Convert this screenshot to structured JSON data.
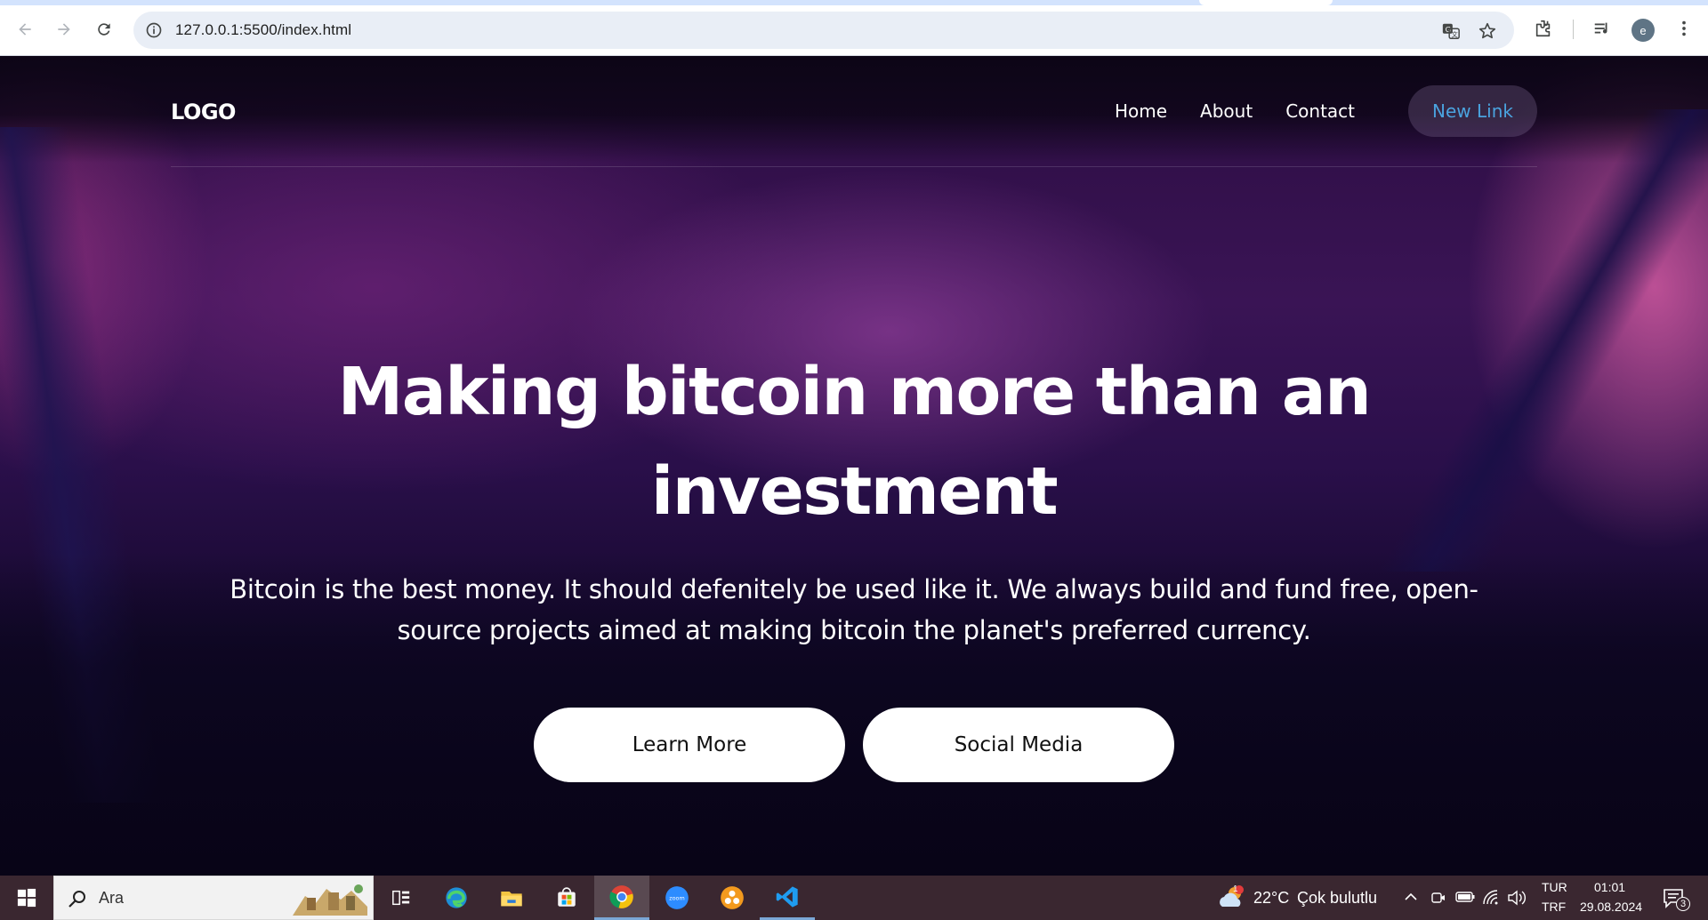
{
  "browser": {
    "url": "127.0.0.1:5500/index.html",
    "profile_initial": "e",
    "icons": [
      "back-icon",
      "forward-icon",
      "reload-icon",
      "site-info-icon",
      "translate-icon",
      "bookmark-star-icon",
      "extensions-icon",
      "media-controls-icon",
      "profile-avatar",
      "more-menu-icon"
    ]
  },
  "site": {
    "logo": "LOGO",
    "nav": [
      "Home",
      "About",
      "Contact"
    ],
    "cta_link": "New Link",
    "hero": {
      "title_line1": "Making bitcoin more than an",
      "title_line2": "investment",
      "text_line1": "Bitcoin is the best money. It should defenitely be used like it. We always build and fund free, open-",
      "text_line2": "source projects aimed at making bitcoin the planet's preferred currency.",
      "buttons": [
        "Learn More",
        "Social Media"
      ]
    },
    "colors": {
      "cta_text": "#4aa3df",
      "button_bg": "#ffffff"
    }
  },
  "taskbar": {
    "search_placeholder": "Ara",
    "apps": [
      "task-view",
      "edge",
      "file-explorer",
      "microsoft-store",
      "chrome",
      "zoom",
      "app-orange",
      "vscode"
    ],
    "weather": {
      "temp": "22°C",
      "desc": "Çok bulutlu",
      "badge": "1"
    },
    "language": {
      "line1": "TUR",
      "line2": "TRF"
    },
    "clock": {
      "time": "01:01",
      "date": "29.08.2024"
    },
    "notifications": "3"
  }
}
